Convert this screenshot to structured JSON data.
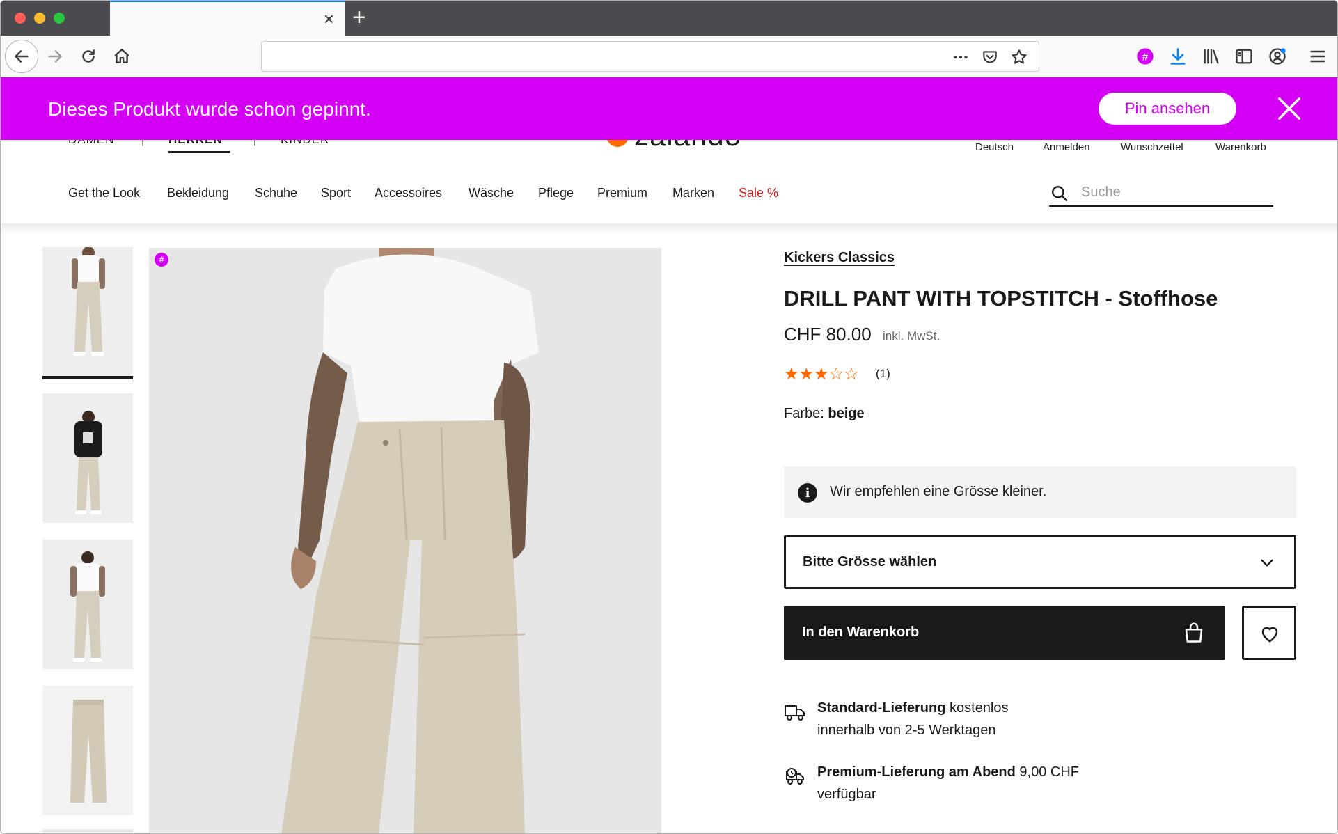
{
  "browser": {
    "tab_close": "×",
    "new_tab": "+",
    "url": ""
  },
  "pin_banner": {
    "message": "Dieses Produkt wurde schon gepinnt.",
    "button": "Pin ansehen",
    "color": "#d400f5"
  },
  "header": {
    "genders": [
      "DAMEN",
      "HERREN",
      "KINDER"
    ],
    "separator": "|",
    "logo": "zalando",
    "utility": [
      "Deutsch",
      "Anmelden",
      "Wunschzettel",
      "Warenkorb"
    ],
    "categories": [
      "Get the Look",
      "Bekleidung",
      "Schuhe",
      "Sport",
      "Accessoires",
      "Wäsche",
      "Pflege",
      "Premium",
      "Marken",
      "Sale %"
    ],
    "search_placeholder": "Suche"
  },
  "gallery": {
    "pin_marker": "#",
    "thumbnails": 4,
    "selected_index": 0
  },
  "product": {
    "brand": "Kickers Classics",
    "title": "DRILL PANT WITH TOPSTITCH - Stoffhose",
    "price": "CHF 80.00",
    "price_note": "inkl. MwSt.",
    "rating": 3,
    "rating_max": 5,
    "stars": "★★★☆☆",
    "reviews": "(1)",
    "color_label": "Farbe:",
    "color_value": "beige",
    "size_hint": "Wir empfehlen eine Grösse kleiner.",
    "size_select": "Bitte Grösse wählen",
    "add_to_cart": "In den Warenkorb",
    "accent_color": "#ff6900"
  },
  "delivery": [
    {
      "bold": "Standard-Lieferung",
      "rest": " kostenlos",
      "line2": "innerhalb von 2-5 Werktagen"
    },
    {
      "bold": "Premium-Lieferung am Abend",
      "rest": " 9,00 CHF",
      "line2": "verfügbar"
    }
  ]
}
